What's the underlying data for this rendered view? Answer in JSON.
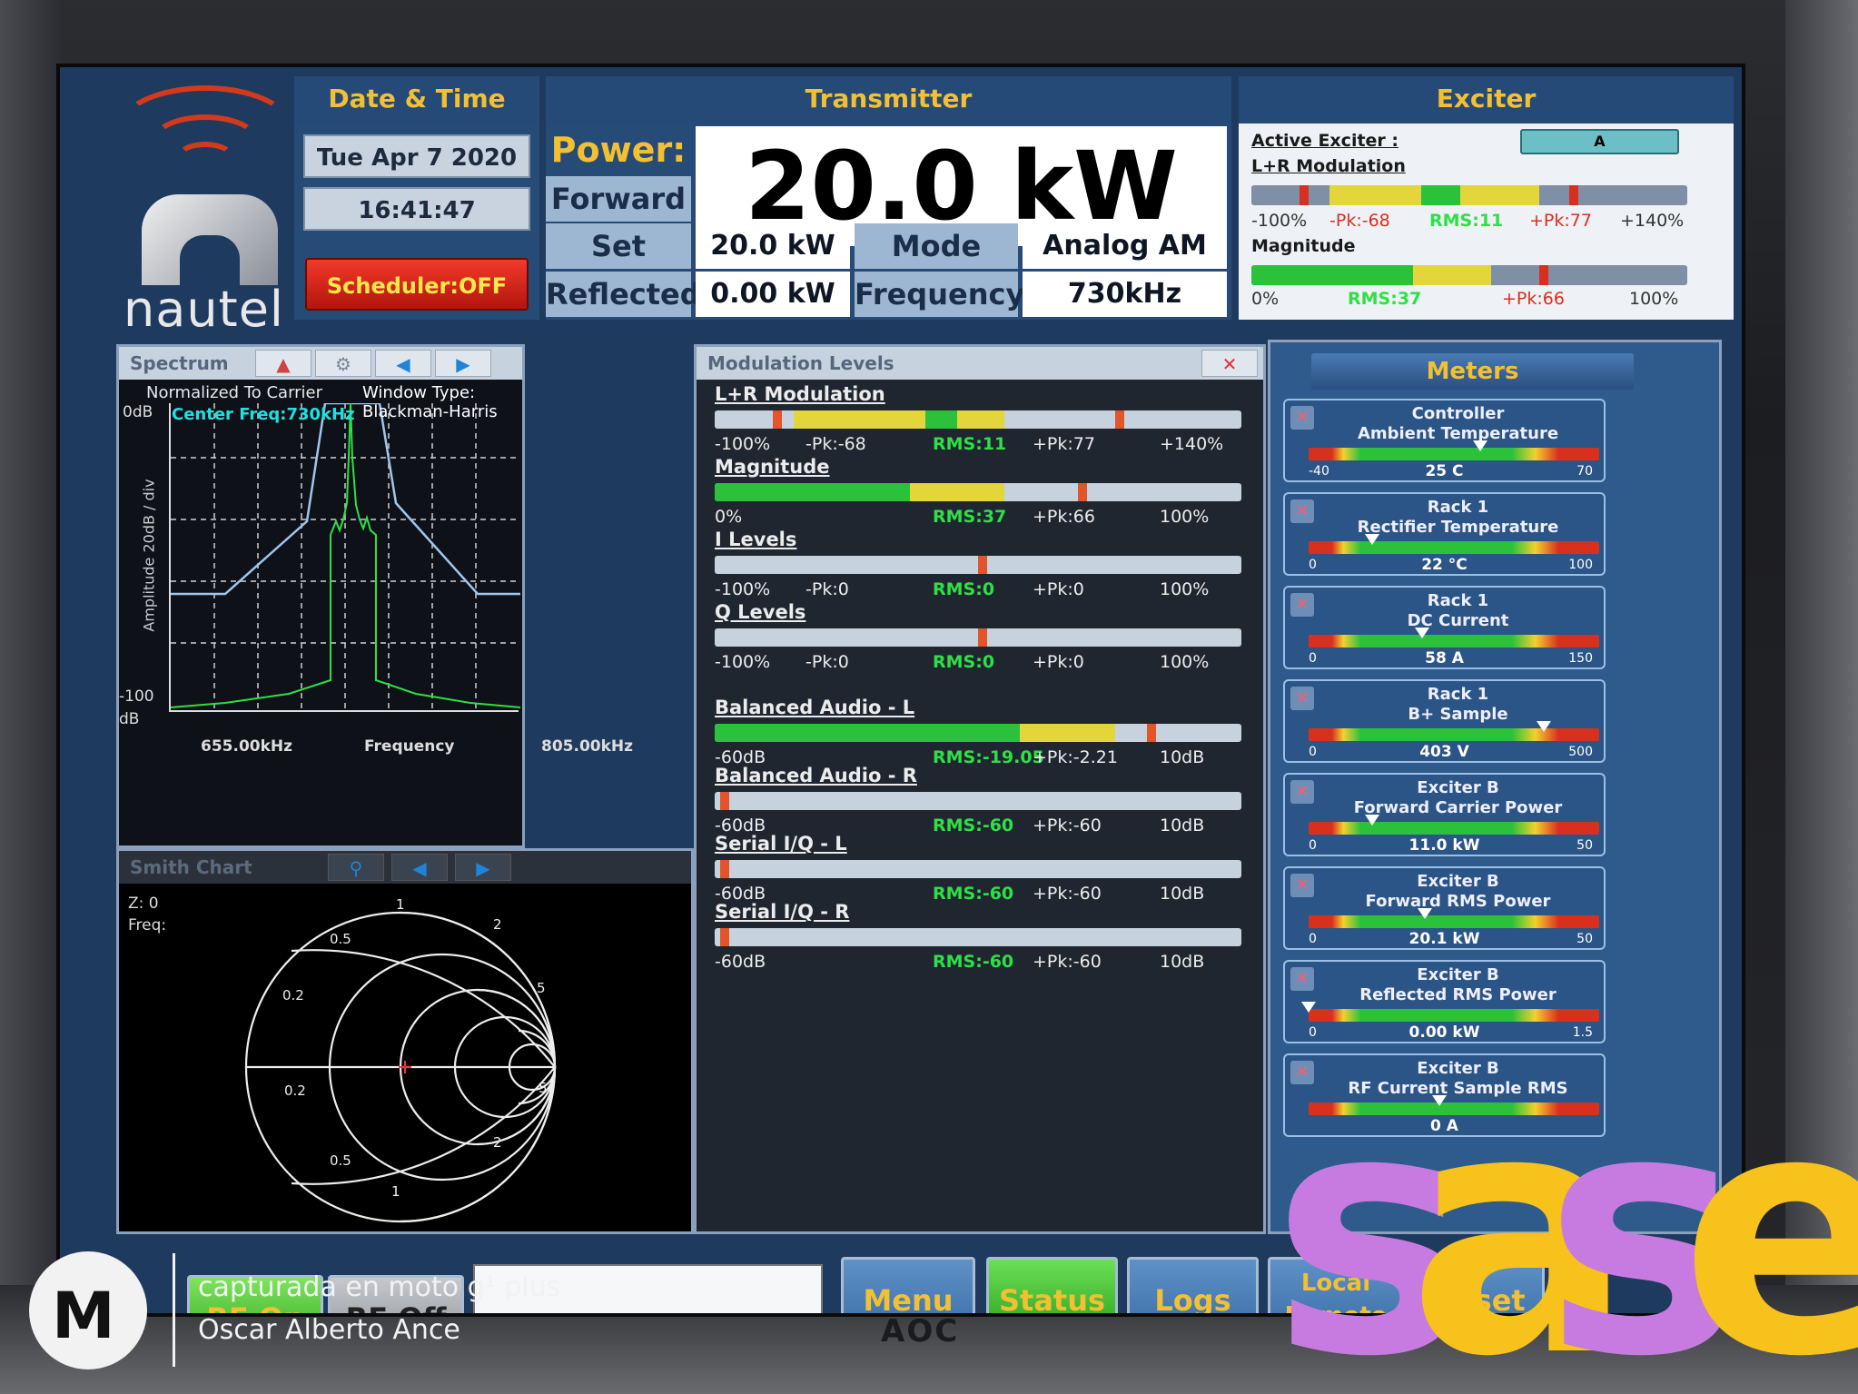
{
  "logo": {
    "name": "nautel"
  },
  "datetime": {
    "title": "Date & Time",
    "date": "Tue Apr 7 2020",
    "time": "16:41:47",
    "scheduler": "Scheduler:OFF"
  },
  "transmitter": {
    "title": "Transmitter",
    "power_label": "Power:",
    "power_value": "20.0 kW",
    "forward_label": "Forward",
    "setpoint_label": "Set Point",
    "setpoint_value": "20.0 kW",
    "mode_label": "Mode",
    "mode_value": "Analog AM",
    "reflected_label": "Reflected",
    "reflected_value": "0.00 kW",
    "frequency_label": "Frequency",
    "frequency_value": "730kHz"
  },
  "exciter": {
    "title": "Exciter",
    "active_label": "Active Exciter :",
    "active_value": "A",
    "lr_label": "L+R Modulation",
    "lr_scale": {
      "min": "-100%",
      "pk_neg": "-Pk:-68",
      "rms": "RMS:11",
      "pk_pos": "+Pk:77",
      "max": "+140%"
    },
    "mag_label": "Magnitude",
    "mag_scale": {
      "min": "0%",
      "rms": "RMS:37",
      "pk": "+Pk:66",
      "max": "100%"
    }
  },
  "spectrum": {
    "title": "Spectrum",
    "normalized": "Normalized To Carrier",
    "window": "Window Type: Blackman-Harris",
    "center": "Center Freq:730kHz",
    "y_top": "0dB",
    "y_bottom": "-100",
    "y_unit": "dB",
    "y_label": "Amplitude 20dB / div",
    "x_min": "655.00kHz",
    "x_label": "Frequency",
    "x_max": "805.00kHz"
  },
  "modulation": {
    "title": "Modulation Levels",
    "meters": [
      {
        "label": "L+R Modulation",
        "min": "-100%",
        "pk_neg": "-Pk:-68",
        "rms": "RMS:11",
        "pk_pos": "+Pk:77",
        "max": "+140%"
      },
      {
        "label": "Magnitude",
        "min": "0%",
        "rms": "RMS:37",
        "pk_pos": "+Pk:66",
        "max": "100%"
      },
      {
        "label": "I Levels",
        "min": "-100%",
        "pk_neg": "-Pk:0",
        "rms": "RMS:0",
        "pk_pos": "+Pk:0",
        "max": "100%"
      },
      {
        "label": "Q Levels",
        "min": "-100%",
        "pk_neg": "-Pk:0",
        "rms": "RMS:0",
        "pk_pos": "+Pk:0",
        "max": "100%"
      },
      {
        "label": "Balanced Audio - L",
        "min": "-60dB",
        "rms": "RMS:-19.05",
        "pk_pos": "+Pk:-2.21",
        "max": "10dB"
      },
      {
        "label": "Balanced Audio - R",
        "min": "-60dB",
        "rms": "RMS:-60",
        "pk_pos": "+Pk:-60",
        "max": "10dB"
      },
      {
        "label": "Serial I/Q - L",
        "min": "-60dB",
        "rms": "RMS:-60",
        "pk_pos": "+Pk:-60",
        "max": "10dB"
      },
      {
        "label": "Serial I/Q - R",
        "min": "-60dB",
        "rms": "RMS:-60",
        "pk_pos": "+Pk:-60",
        "max": "10dB"
      }
    ]
  },
  "smith": {
    "title": "Smith Chart",
    "z": "Z: 0",
    "freq": "Freq:",
    "labels": [
      "1",
      "2",
      "0.5",
      "0.2",
      "5",
      "5",
      "0.2",
      "2",
      "0.5",
      "1"
    ]
  },
  "meters": {
    "title": "Meters",
    "items": [
      {
        "t1": "Controller",
        "t2": "Ambient Temperature",
        "min": "-40",
        "val": "25 C",
        "max": "70",
        "level": 0.59
      },
      {
        "t1": "Rack 1",
        "t2": "Rectifier Temperature",
        "min": "0",
        "val": "22 °C",
        "max": "100",
        "level": 0.22
      },
      {
        "t1": "Rack 1",
        "t2": "DC Current",
        "min": "0",
        "val": "58 A",
        "max": "150",
        "level": 0.39
      },
      {
        "t1": "Rack 1",
        "t2": "B+ Sample",
        "min": "0",
        "val": "403 V",
        "max": "500",
        "level": 0.81
      },
      {
        "t1": "Exciter B",
        "t2": "Forward Carrier Power",
        "min": "0",
        "val": "11.0 kW",
        "max": "50",
        "level": 0.22
      },
      {
        "t1": "Exciter B",
        "t2": "Forward RMS Power",
        "min": "0",
        "val": "20.1 kW",
        "max": "50",
        "level": 0.4
      },
      {
        "t1": "Exciter B",
        "t2": "Reflected RMS Power",
        "min": "0",
        "val": "0.00 kW",
        "max": "1.5",
        "level": 0.0
      },
      {
        "t1": "Exciter B",
        "t2": "RF Current Sample RMS",
        "min": "",
        "val": "0 A",
        "max": "",
        "level": 0.45
      }
    ]
  },
  "footer": {
    "rf_on": "RF On",
    "rf_off": "RF Off",
    "menu": "Menu",
    "status": "Status",
    "logs": "Logs",
    "local_remote": "Local Remote",
    "reset": "Reset"
  },
  "watermark": {
    "line1": "capturada en moto g¹ plus",
    "line2": "Oscar Alberto Ance",
    "sticker": "sase",
    "monitor_brand": "AOC"
  },
  "colors": {
    "panel_blue": "#274b77",
    "title_yellow": "#f2c032",
    "rf_green": "#2ea11b",
    "alarm_red": "#d8301f",
    "sticker_purple": "#c77be0",
    "sticker_yellow": "#f6c21b"
  }
}
